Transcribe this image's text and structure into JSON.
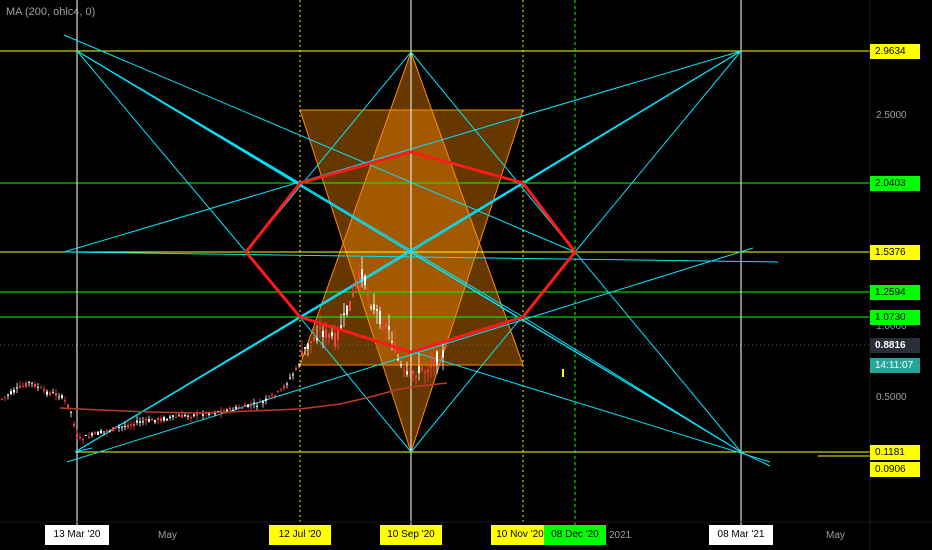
{
  "indicator_label": "MA (200, ohlc4, 0)",
  "price_axis": {
    "tags": [
      {
        "value": "2.9634",
        "style": "yellow"
      },
      {
        "value": "2.0403",
        "style": "green"
      },
      {
        "value": "1.5376",
        "style": "yellow"
      },
      {
        "value": "1.2594",
        "style": "green"
      },
      {
        "value": "1.0730",
        "style": "green"
      },
      {
        "value": "0.8816",
        "style": "gray"
      },
      {
        "value": "14:11:07",
        "style": "teal"
      },
      {
        "value": "0.1181",
        "style": "yellow"
      },
      {
        "value": "0.0906",
        "style": "yellow"
      }
    ],
    "plain_labels": [
      "2.5000",
      "1.0000",
      "0.5000"
    ]
  },
  "time_axis": {
    "tags": [
      {
        "value": "13 Mar '20",
        "style": "white"
      },
      {
        "value": "12 Jul '20",
        "style": "yellow"
      },
      {
        "value": "10 Sep '20",
        "style": "yellow"
      },
      {
        "value": "10 Nov '20",
        "style": "yellow"
      },
      {
        "value": "08 Dec '20",
        "style": "green"
      },
      {
        "value": "08 Mar '21",
        "style": "white"
      }
    ],
    "plain_labels": [
      "May",
      "2021",
      "May"
    ]
  },
  "colors": {
    "background": "#000000",
    "yellow": "#ffff00",
    "green": "#00ff00",
    "cyan": "#00e5ff",
    "red": "#ff1a1a",
    "orange": "#ff8c00",
    "candle_up": "#ffffff",
    "candle_down": "#ff4040",
    "ma_line": "#c0392b"
  }
}
